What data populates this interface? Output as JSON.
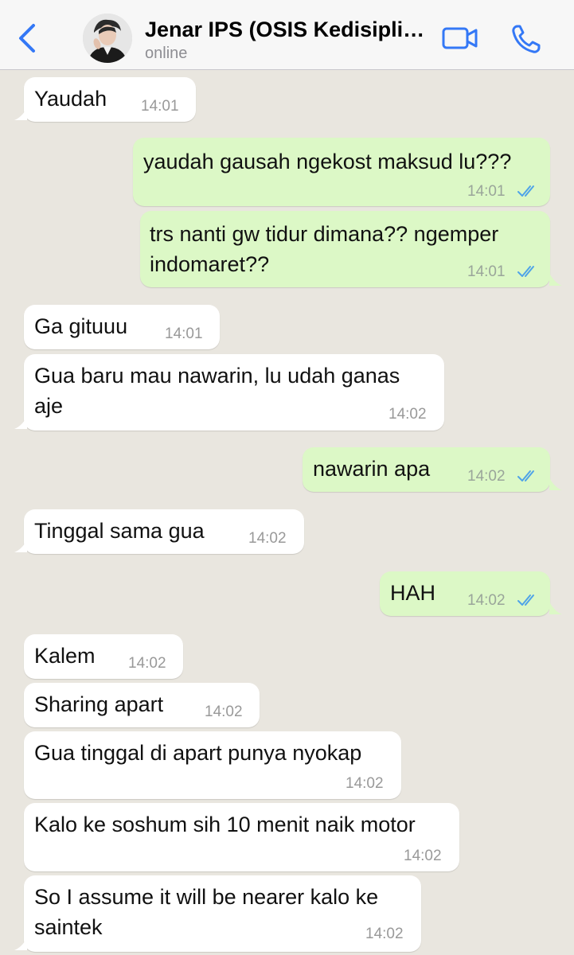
{
  "header": {
    "contact_name": "Jenar IPS (OSIS Kedisiplinan)",
    "status": "online",
    "avatar_icon": "profile-photo",
    "accent_color": "#3478f6"
  },
  "messages": [
    {
      "direction": "in",
      "text": "Yaudah",
      "time": "14:01"
    },
    {
      "direction": "out",
      "text": "yaudah gausah ngekost maksud lu???",
      "time": "14:01",
      "read": true
    },
    {
      "direction": "out",
      "text_line1": "trs nanti gw tidur dimana?? ngemper",
      "text_line2": "indomaret??",
      "time": "14:01",
      "read": true
    },
    {
      "direction": "in",
      "text": "Ga gituuu",
      "time": "14:01"
    },
    {
      "direction": "in",
      "text_line1": "Gua baru mau nawarin, lu udah ganas",
      "text_line2": "aje",
      "time": "14:02"
    },
    {
      "direction": "out",
      "text": "nawarin apa",
      "time": "14:02",
      "read": true
    },
    {
      "direction": "in",
      "text": "Tinggal sama gua",
      "time": "14:02"
    },
    {
      "direction": "out",
      "text": "HAH",
      "time": "14:02",
      "read": true
    },
    {
      "direction": "in",
      "text": "Kalem",
      "time": "14:02"
    },
    {
      "direction": "in",
      "text": "Sharing apart",
      "time": "14:02"
    },
    {
      "direction": "in",
      "text": "Gua tinggal di apart punya nyokap",
      "time": "14:02"
    },
    {
      "direction": "in",
      "text": "Kalo ke soshum sih 10 menit naik motor",
      "time": "14:02"
    },
    {
      "direction": "in",
      "text_line1": "So I assume it will be nearer kalo ke",
      "text_line2": "saintek",
      "time": "14:02"
    }
  ]
}
